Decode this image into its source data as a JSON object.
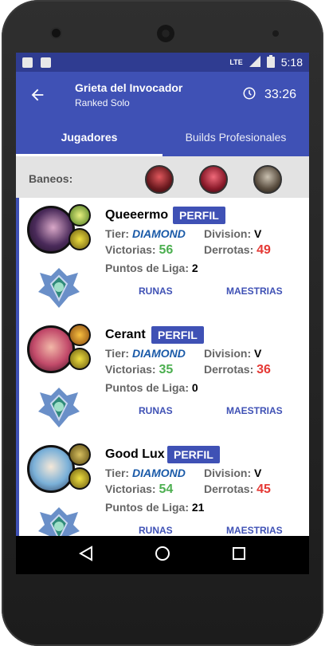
{
  "status": {
    "time": "5:18",
    "network": "LTE"
  },
  "appbar": {
    "title": "Grieta del Invocador",
    "subtitle": "Ranked Solo",
    "timer": "33:26"
  },
  "tabs": [
    {
      "label": "Jugadores"
    },
    {
      "label": "Builds Profesionales"
    }
  ],
  "bans": {
    "label": "Baneos:"
  },
  "players": [
    {
      "name": "Queeermo",
      "profile_label": "PERFIL",
      "tier_label": "Tier:",
      "tier": "DIAMOND",
      "division_label": "Division:",
      "division": "V",
      "wins_label": "Victorias:",
      "wins": "56",
      "losses_label": "Derrotas:",
      "losses": "49",
      "lp_label": "Puntos de Liga:",
      "lp": "2",
      "runes_label": "RUNAS",
      "masteries_label": "MAESTRIAS"
    },
    {
      "name": "Cerant",
      "profile_label": "PERFIL",
      "tier_label": "Tier:",
      "tier": "DIAMOND",
      "division_label": "Division:",
      "division": "V",
      "wins_label": "Victorias:",
      "wins": "35",
      "losses_label": "Derrotas:",
      "losses": "36",
      "lp_label": "Puntos de Liga:",
      "lp": "0",
      "runes_label": "RUNAS",
      "masteries_label": "MAESTRIAS"
    },
    {
      "name": "Good Lux",
      "profile_label": "PERFIL",
      "tier_label": "Tier:",
      "tier": "DIAMOND",
      "division_label": "Division:",
      "division": "V",
      "wins_label": "Victorias:",
      "wins": "54",
      "losses_label": "Derrotas:",
      "losses": "45",
      "lp_label": "Puntos de Liga:",
      "lp": "21",
      "runes_label": "RUNAS",
      "masteries_label": "MAESTRIAS"
    }
  ],
  "colors": {
    "primary": "#3f51b5",
    "win": "#4caf50",
    "loss": "#e53935",
    "tier": "#1a5aa8"
  }
}
